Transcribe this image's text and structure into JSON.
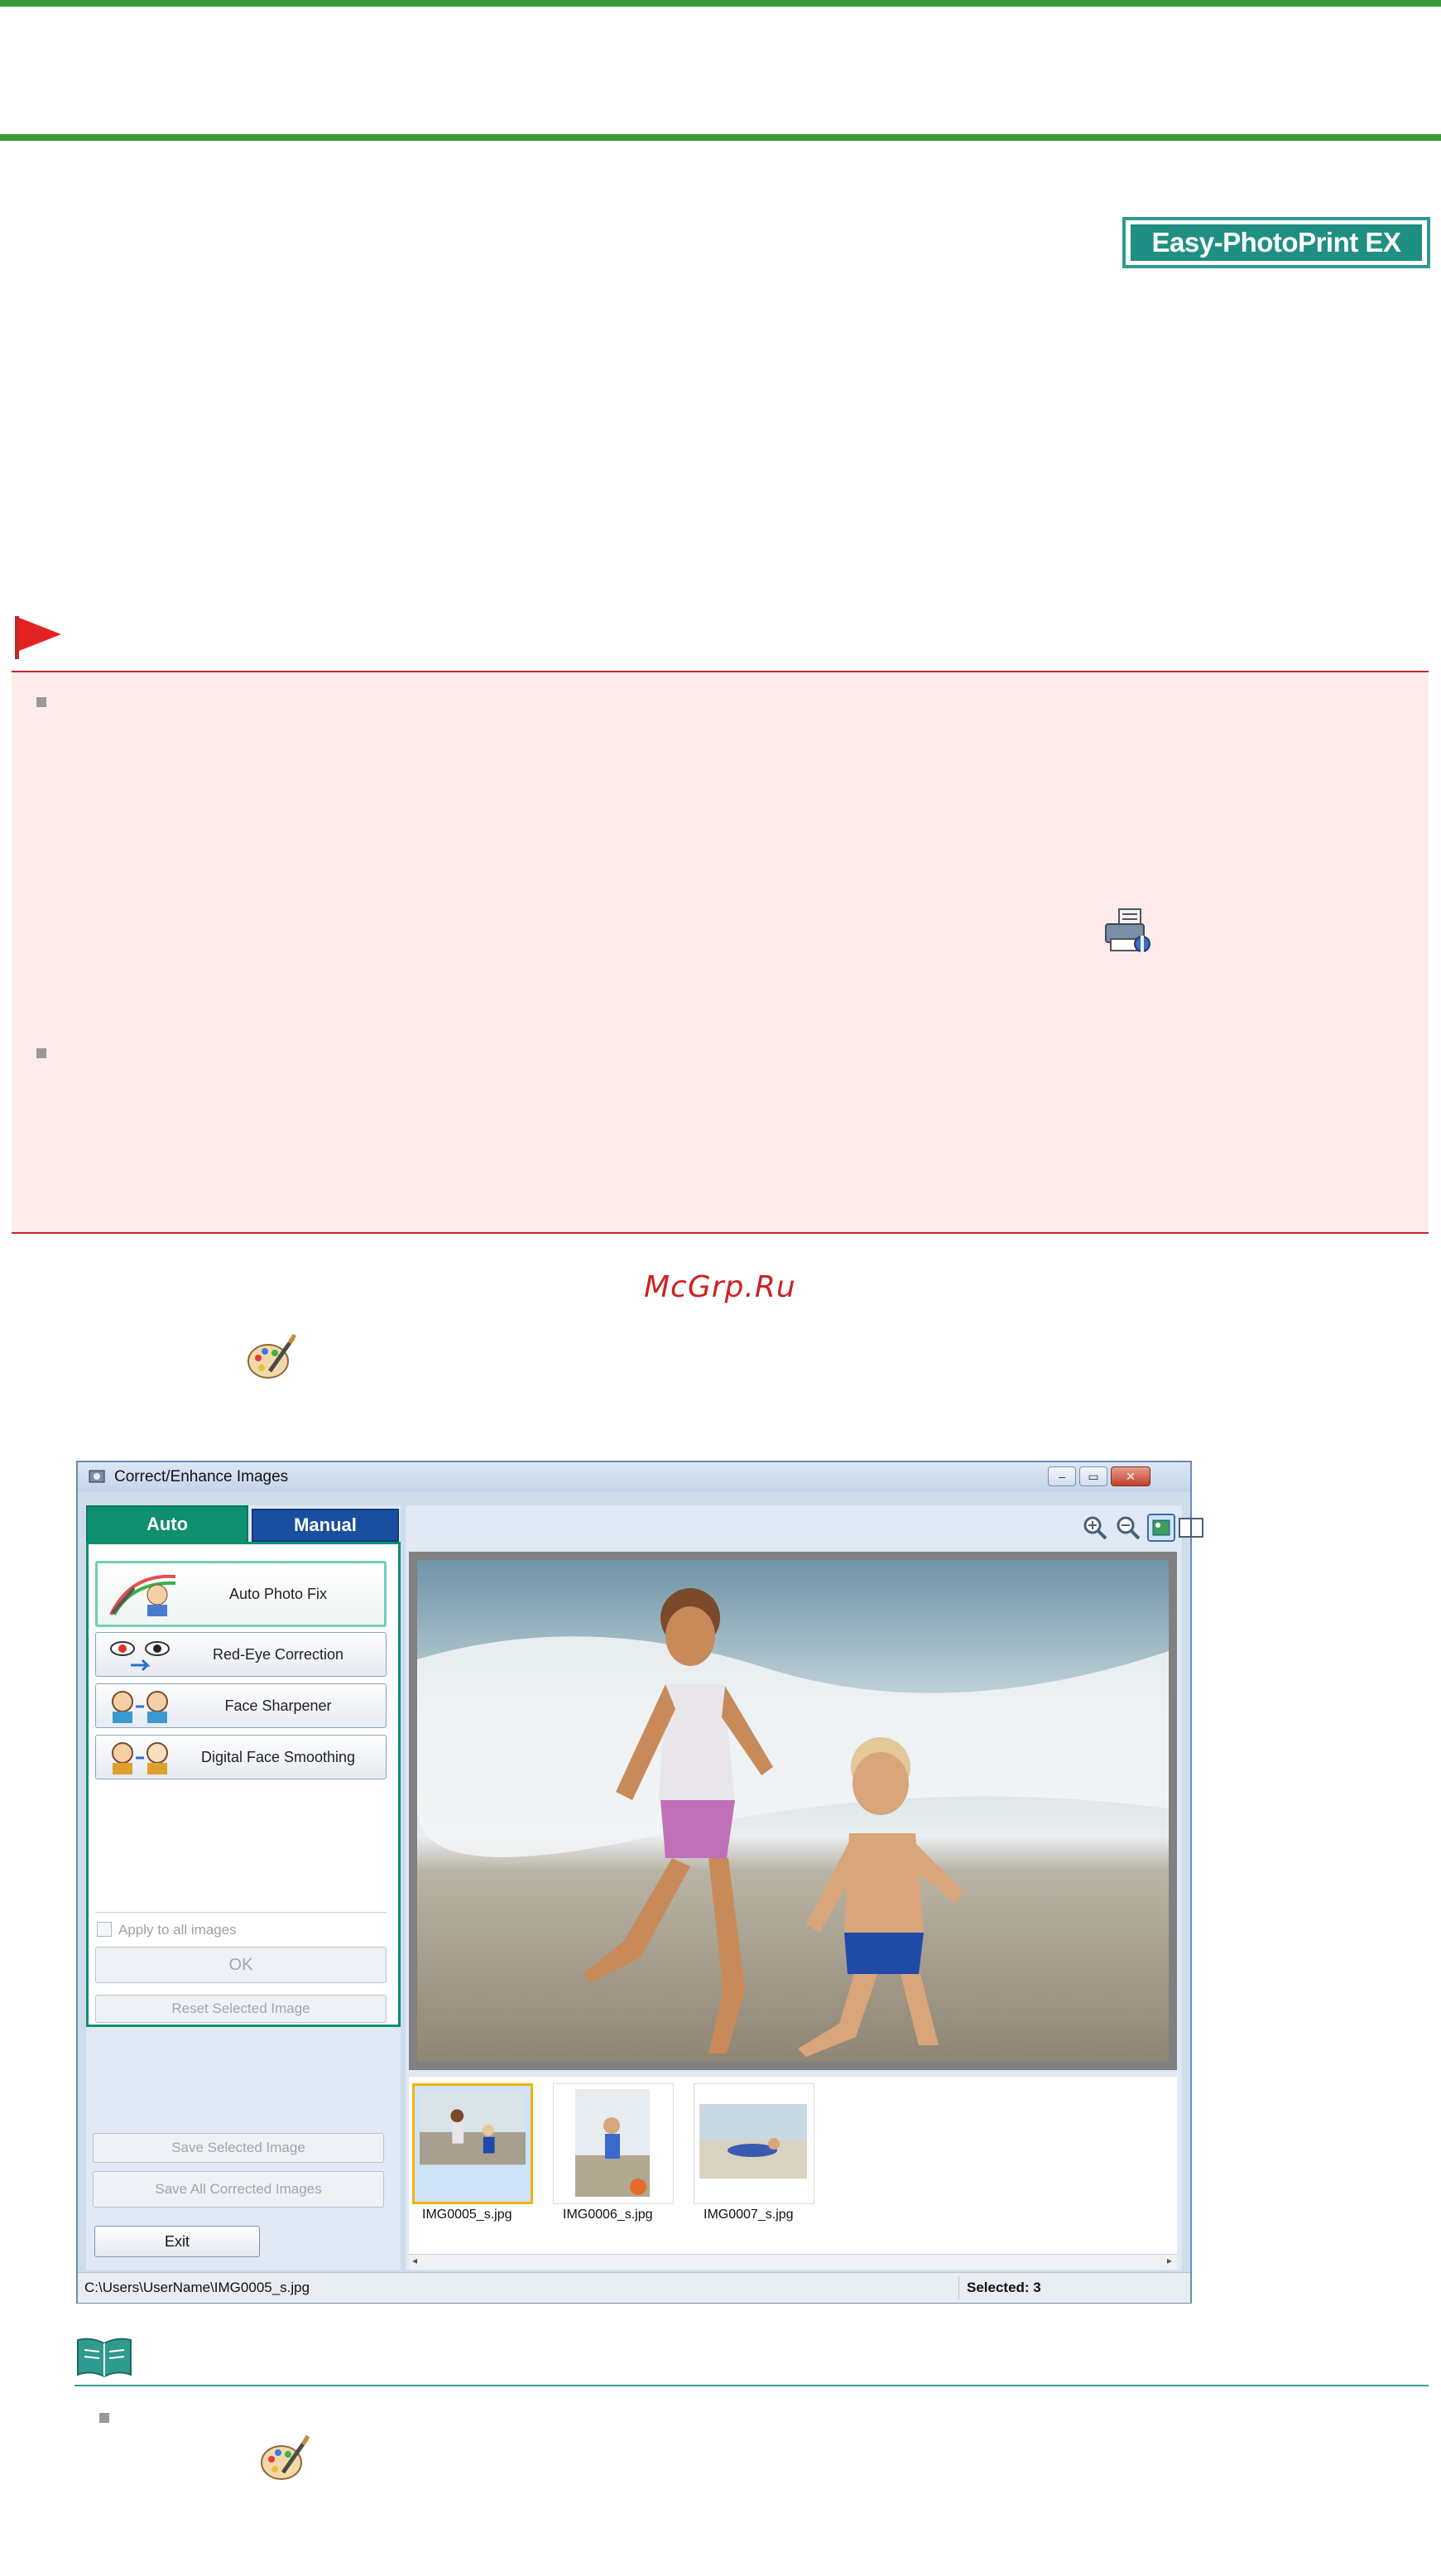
{
  "logo": {
    "text": "Easy-PhotoPrint EX"
  },
  "watermark": {
    "text": "McGrp.Ru"
  },
  "window": {
    "title": "Correct/Enhance Images",
    "controls": {
      "minimize": "–",
      "maximize": "▭",
      "close": "✕"
    },
    "tabs": {
      "auto": "Auto",
      "manual": "Manual"
    },
    "functions": [
      {
        "label": "Auto Photo Fix",
        "selected": true
      },
      {
        "label": "Red-Eye Correction",
        "selected": false
      },
      {
        "label": "Face Sharpener",
        "selected": false
      },
      {
        "label": "Digital Face Smoothing",
        "selected": false
      }
    ],
    "apply_all_label": "Apply to all images",
    "ok_label": "OK",
    "reset_label": "Reset Selected Image",
    "save_selected_label": "Save Selected Image",
    "save_all_label": "Save All Corrected Images",
    "exit_label": "Exit",
    "thumbnails": [
      {
        "caption": "IMG0005_s.jpg",
        "selected": true
      },
      {
        "caption": "IMG0006_s.jpg",
        "selected": false
      },
      {
        "caption": "IMG0007_s.jpg",
        "selected": false
      }
    ],
    "status": {
      "path": "C:\\Users\\UserName\\IMG0005_s.jpg",
      "selected": "Selected: 3"
    }
  },
  "colors": {
    "green_rule": "#3a9a3a",
    "important_red": "#c0282b",
    "important_bg": "#fdeceb",
    "tab_auto": "#0e8f6f",
    "tab_manual": "#1a4fa0"
  }
}
